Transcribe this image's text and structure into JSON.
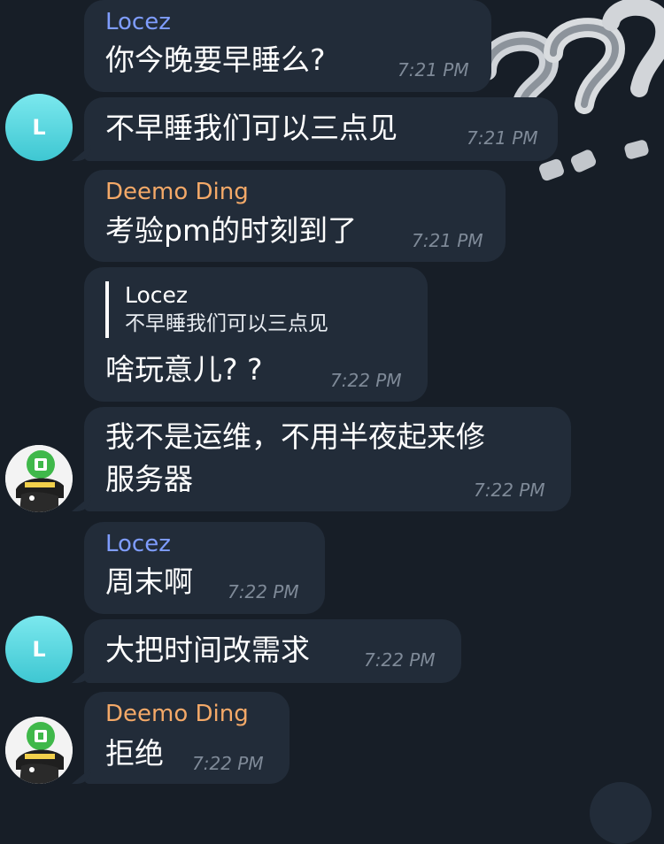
{
  "messages": [
    {
      "sender": "Locez",
      "text": "你今晚要早睡么?",
      "time": "7:21 PM"
    },
    {
      "text": "不早睡我们可以三点见",
      "time": "7:21 PM",
      "avatar_letter": "L"
    },
    {
      "sender": "Deemo Ding",
      "text": "考验pm的时刻到了",
      "time": "7:21 PM"
    },
    {
      "reply_name": "Locez",
      "reply_text": "不早睡我们可以三点见",
      "text": "啥玩意儿? ?",
      "time": "7:22 PM"
    },
    {
      "text_line1": "我不是运维，不用半夜起来修",
      "text_line2": "服务器",
      "time": "7:22 PM"
    },
    {
      "sender": "Locez",
      "text": "周末啊",
      "time": "7:22 PM"
    },
    {
      "text": "大把时间改需求",
      "time": "7:22 PM",
      "avatar_letter": "L"
    },
    {
      "sender": "Deemo Ding",
      "text": "拒绝",
      "time": "7:22 PM"
    }
  ],
  "colors": {
    "background": "#171e27",
    "bubble": "#222c39",
    "sender_locez": "#7f9dff",
    "sender_deemo": "#f4a968",
    "time": "#7f8a98"
  },
  "icons": [
    "question-marks-sticker",
    "cartoon-avatar"
  ]
}
